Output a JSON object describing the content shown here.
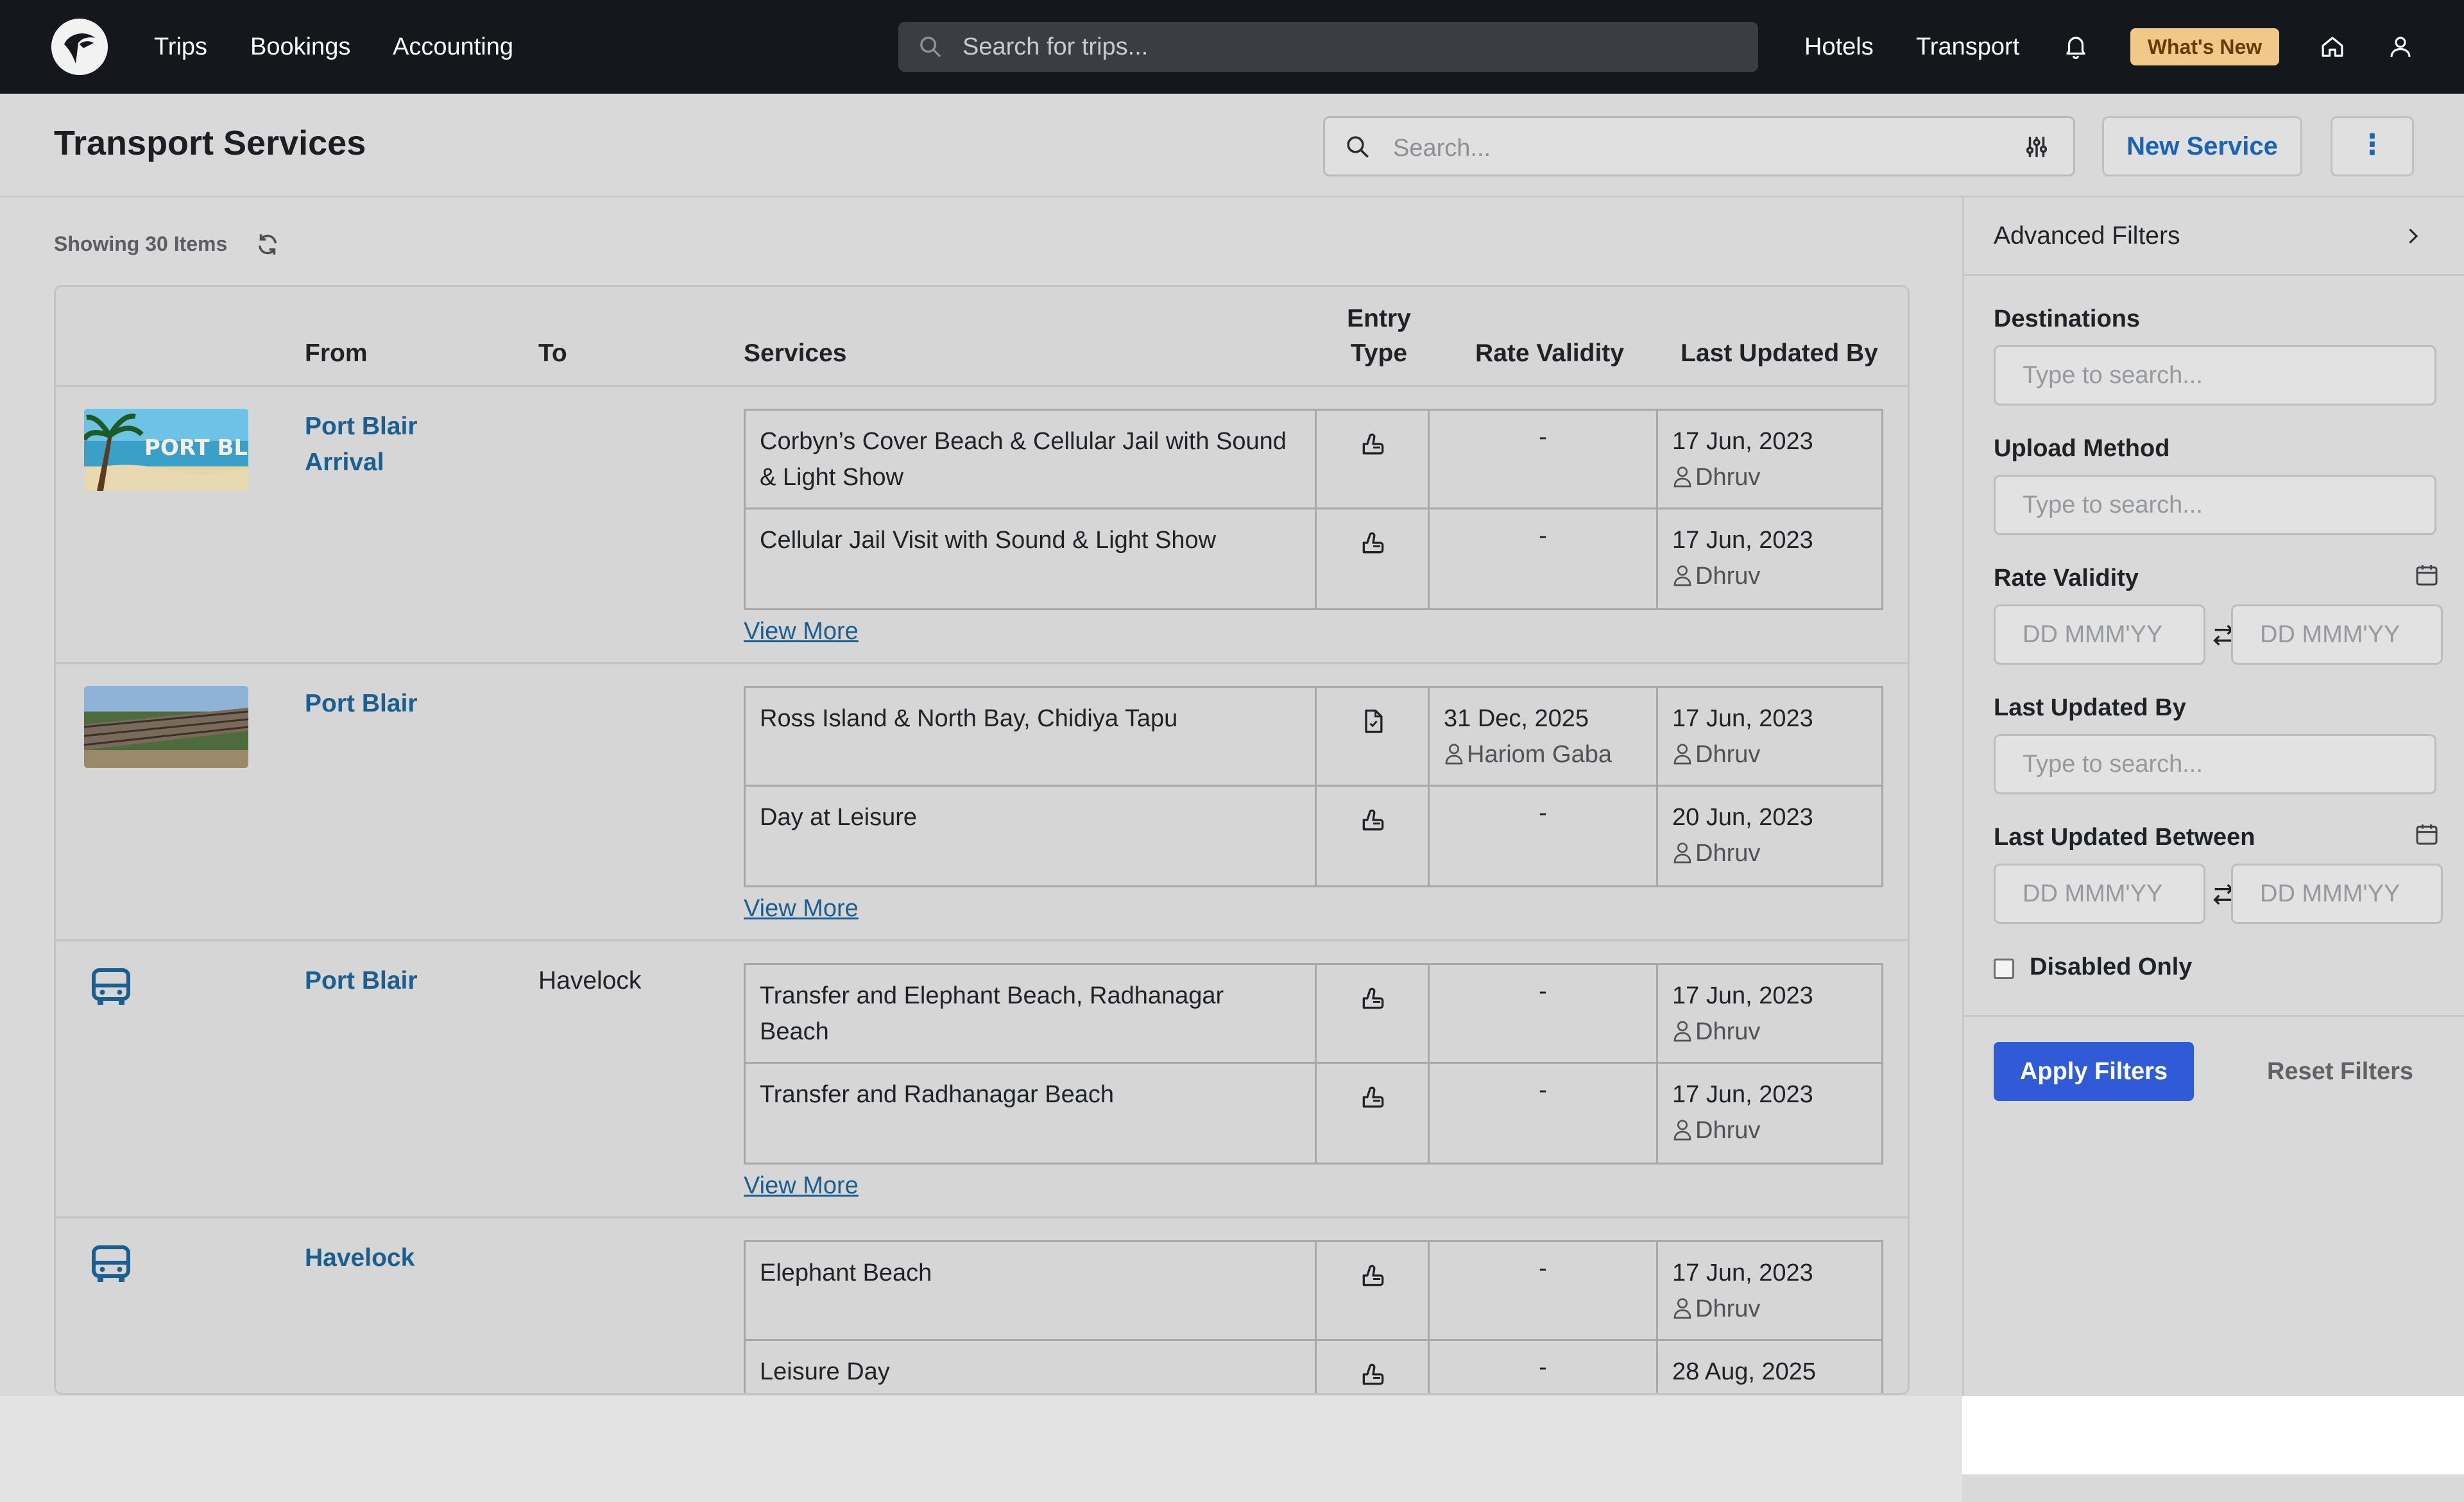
{
  "nav": {
    "links": [
      "Trips",
      "Bookings",
      "Accounting"
    ],
    "search_placeholder": "Search for trips...",
    "right_links": [
      "Hotels",
      "Transport"
    ],
    "whats_new": "What's New"
  },
  "page": {
    "title": "Transport Services",
    "search_placeholder": "Search...",
    "new_service": "New Service",
    "more": "⋮",
    "showing": "Showing 30 Items"
  },
  "table": {
    "headers": {
      "from": "From",
      "to": "To",
      "services": "Services",
      "entry_type_1": "Entry",
      "entry_type_2": "Type",
      "rate_validity": "Rate Validity",
      "last_updated_by": "Last Updated By"
    },
    "groups": [
      {
        "from": "Port Blair Arrival",
        "to": "",
        "image": "port-blair-beach-thumbnail",
        "services": [
          {
            "name": "Corbyn’s Cover Beach & Cellular Jail with Sound & Light Show",
            "entry": "manual",
            "rate": "-",
            "rate_by": "",
            "date": "17 Jun, 2023",
            "by": "Dhruv"
          },
          {
            "name": "Cellular Jail Visit with Sound & Light Show",
            "entry": "manual",
            "rate": "-",
            "rate_by": "",
            "date": "17 Jun, 2023",
            "by": "Dhruv"
          }
        ],
        "view_more": "View More"
      },
      {
        "from": "Port Blair",
        "to": "",
        "image": "cellular-jail-thumbnail",
        "services": [
          {
            "name": "Ross Island & North Bay, Chidiya Tapu",
            "entry": "file",
            "rate": "31 Dec, 2025",
            "rate_by": "Hariom Gaba",
            "date": "17 Jun, 2023",
            "by": "Dhruv"
          },
          {
            "name": "Day at Leisure",
            "entry": "manual",
            "rate": "-",
            "rate_by": "",
            "date": "20 Jun, 2023",
            "by": "Dhruv"
          }
        ],
        "view_more": "View More"
      },
      {
        "from": "Port Blair",
        "to": "Havelock",
        "image": "bus-icon",
        "services": [
          {
            "name": "Transfer and Elephant Beach, Radhanagar Beach",
            "entry": "manual",
            "rate": "-",
            "rate_by": "",
            "date": "17 Jun, 2023",
            "by": "Dhruv"
          },
          {
            "name": "Transfer and Radhanagar Beach",
            "entry": "manual",
            "rate": "-",
            "rate_by": "",
            "date": "17 Jun, 2023",
            "by": "Dhruv"
          }
        ],
        "view_more": "View More"
      },
      {
        "from": "Havelock",
        "to": "",
        "image": "bus-icon",
        "services": [
          {
            "name": "Elephant Beach",
            "entry": "manual",
            "rate": "-",
            "rate_by": "",
            "date": "17 Jun, 2023",
            "by": "Dhruv"
          },
          {
            "name": "Leisure Day",
            "entry": "manual",
            "rate": "-",
            "rate_by": "",
            "date": "28 Aug, 2025",
            "by": ""
          }
        ],
        "view_more": ""
      }
    ]
  },
  "filters": {
    "title": "Advanced Filters",
    "destinations_label": "Destinations",
    "destinations_placeholder": "Type to search...",
    "upload_label": "Upload Method",
    "upload_placeholder": "Type to search...",
    "rate_label": "Rate Validity",
    "date_placeholder": "DD MMM'YY",
    "updated_by_label": "Last Updated By",
    "updated_by_placeholder": "Type to search...",
    "updated_between_label": "Last Updated Between",
    "disabled_only": "Disabled Only",
    "apply": "Apply Filters",
    "reset": "Reset Filters"
  },
  "colors": {
    "nav_bg": "#14171c",
    "accent": "#2f5cd6",
    "link": "#1a5f8f",
    "whats_new_bg": "#f0c989"
  }
}
